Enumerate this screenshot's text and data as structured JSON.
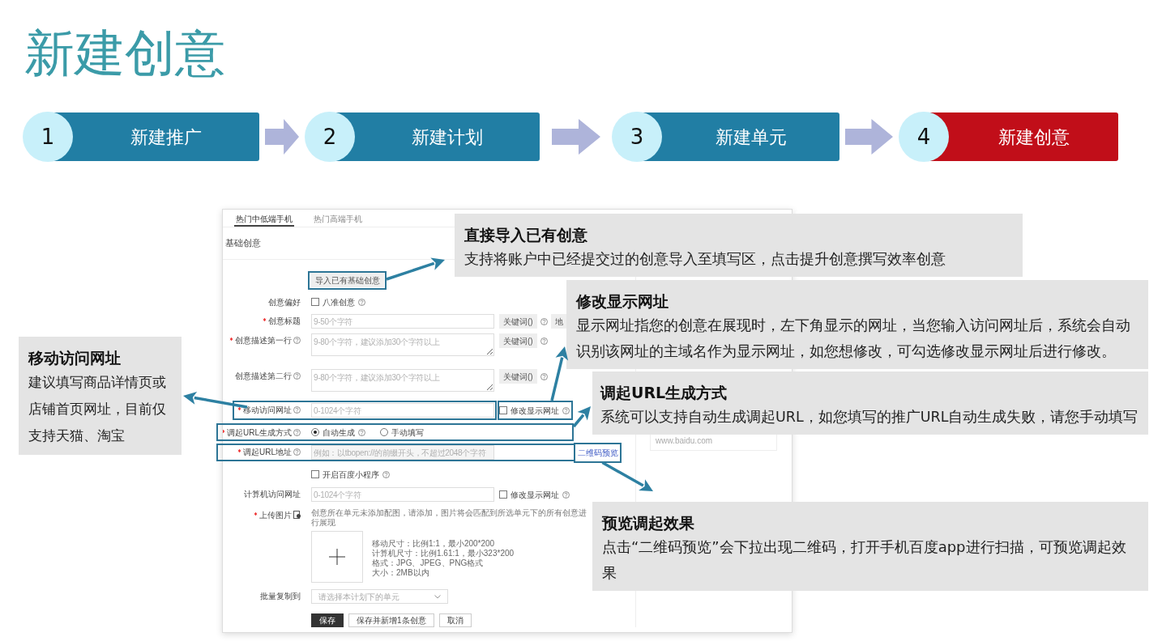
{
  "title": "新建创意",
  "steps": [
    {
      "number": "1",
      "label": "新建推广",
      "selected": false
    },
    {
      "number": "2",
      "label": "新建计划",
      "selected": false
    },
    {
      "number": "3",
      "label": "新建单元",
      "selected": false
    },
    {
      "number": "4",
      "label": "新建创意",
      "selected": true
    }
  ],
  "form": {
    "tabs": [
      {
        "label": "热门中低端手机",
        "selected": true
      },
      {
        "label": "热门高端手机",
        "selected": false
      }
    ],
    "section": "基础创意",
    "import_button": "导入已有基础创意",
    "fields": [
      {
        "kind": "checkbox",
        "label": "创意偏好",
        "option": "八准创意",
        "checked": false,
        "option_help": true
      },
      {
        "kind": "input",
        "label": "创意标题",
        "required": true,
        "placeholder": "9-50个字符",
        "side": [
          {
            "kind": "button",
            "text": "关键词()"
          },
          {
            "kind": "help"
          },
          {
            "kind": "button",
            "text": "地"
          }
        ]
      },
      {
        "kind": "textarea",
        "label": "创意描述第一行",
        "required": true,
        "label_help": true,
        "placeholder": "9-80个字符，建议添加30个字符以上",
        "side": [
          {
            "kind": "button",
            "text": "关键词()"
          },
          {
            "kind": "help"
          }
        ]
      },
      {
        "kind": "textarea",
        "label": "创意描述第二行",
        "label_help": true,
        "placeholder": "9-80个字符，建议添加30个字符以上",
        "side": [
          {
            "kind": "button",
            "text": "关键词()"
          },
          {
            "kind": "help"
          }
        ]
      },
      {
        "kind": "input",
        "label": "移动访问网址",
        "required": true,
        "label_help": true,
        "placeholder": "0-1024个字符",
        "side": [
          {
            "kind": "checkbox",
            "text": "修改显示网址",
            "checked": false
          },
          {
            "kind": "help"
          }
        ]
      },
      {
        "kind": "radio",
        "label": "调起URL生成方式",
        "required": true,
        "label_help": true,
        "options": [
          {
            "text": "自动生成",
            "selected": true,
            "help": true
          },
          {
            "text": "手动填写",
            "selected": false
          }
        ]
      },
      {
        "kind": "input",
        "label": "调起URL地址",
        "required": true,
        "label_help": true,
        "placeholder": "例如：以tbopen://的前缀开头，不超过2048个字符",
        "disabled": true,
        "side": [
          {
            "kind": "link",
            "text": "二维码预览"
          }
        ]
      },
      {
        "kind": "checkbox",
        "option": "开启百度小程序",
        "checked": false,
        "option_help": true
      },
      {
        "kind": "input",
        "label": "计算机访问网址",
        "placeholder": "0-1024个字符",
        "side": [
          {
            "kind": "checkbox",
            "text": "修改显示网址",
            "checked": false
          },
          {
            "kind": "help"
          }
        ]
      },
      {
        "kind": "upload",
        "label": "上传图片",
        "required": true,
        "note": "创意所在单元未添加配图，请添加，图片将会匹配到所选单元下的所有创意进行展现",
        "hints": [
          "移动尺寸：比例1:1，最小200*200",
          "计算机尺寸：比例1.61:1，最小323*200",
          "格式：JPG、JPEG、PNG格式",
          "大小：2MB以内"
        ]
      },
      {
        "kind": "select",
        "label": "批量复制到",
        "placeholder": "请选择本计划下的单元"
      }
    ],
    "buttons": [
      {
        "text": "保存",
        "kind": "primary"
      },
      {
        "text": "保存并新增1条创意",
        "kind": "default"
      },
      {
        "text": "取消",
        "kind": "default"
      }
    ]
  },
  "preview": {
    "url": "www.baidu.com"
  },
  "callouts": [
    {
      "title": "直接导入已有创意",
      "text": "支持将账户中已经提交过的创意导入至填写区，点击提升创意撰写效率创意"
    },
    {
      "title": "修改显示网址",
      "text": "显示网址指您的创意在展现时，左下角显示的网址，当您输入访问网址后，系统会自动识别该网址的主域名作为显示网址，如您想修改，可勾选修改显示网址后进行修改。"
    },
    {
      "title": "调起URL生成方式",
      "text": "系统可以支持自动生成调起URL，如您填写的推广URL自动生成失败，请您手动填写"
    },
    {
      "title": "预览调起效果",
      "text": "点击“二维码预览”会下拉出现二维码，打开手机百度app进行扫描，可预览调起效果"
    },
    {
      "title": "移动访问网址",
      "text": "建议填写商品详情页或店铺首页网址，目前仅支持天猫、淘宝"
    }
  ]
}
